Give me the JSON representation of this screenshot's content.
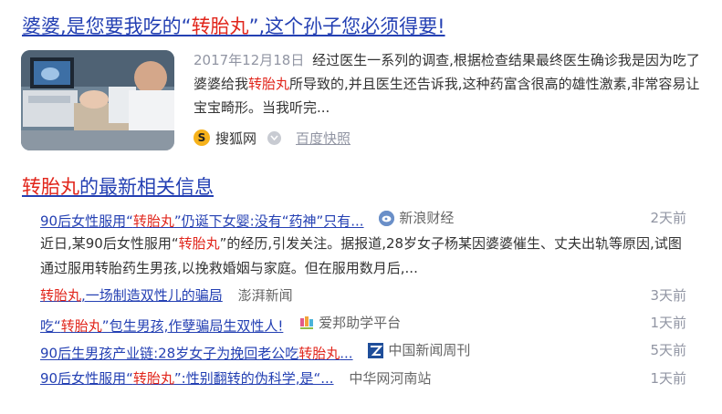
{
  "result1": {
    "title_pre": "婆婆,是您要我吃的“",
    "title_hl": "转胎丸",
    "title_post": "”,这个孙子您必须得要!",
    "date": "2017年12月18日",
    "abstract_1": "经过医生一系列的调查,根据检查结果最终医生确诊我是因为吃了婆婆给我",
    "abstract_hl": "转胎丸",
    "abstract_2": "所导致的,并且医生还告诉我,这种药富含很高的雄性激素,非常容易让宝宝畸形。当我听完...",
    "source_logo_char": "S",
    "source": "搜狐网",
    "kuaizhao": "百度快照"
  },
  "section": {
    "title_hl": "转胎丸",
    "title_rest": "的最新相关信息"
  },
  "news": [
    {
      "title_pre": "90后女性服用“",
      "title_hl": "转胎丸",
      "title_post": "”仍诞下女婴:没有“药神”只有...",
      "source": "新浪财经",
      "source_icon": "sina-finance-icon",
      "time": "2天前",
      "abstract_1": "近日,某90后女性服用“",
      "abstract_hl": "转胎丸",
      "abstract_2": "”的经历,引发关注。据报道,28岁女子杨某因婆婆催生、丈夫出轨等原因,试图通过服用转胎药生男孩,以挽救婚姻与家庭。但在服用数月后,..."
    },
    {
      "title_pre": "",
      "title_hl": "转胎丸",
      "title_post": ",一场制造双性儿的骗局",
      "source": "澎湃新闻",
      "time": "3天前"
    },
    {
      "title_pre": "吃“",
      "title_hl": "转胎丸",
      "title_post": "”包生男孩,作孽骗局生双性人!",
      "source": "爱邦助学平台",
      "source_icon": "aibang-icon",
      "time": "1天前"
    },
    {
      "title_pre": "90后生男孩产业链:28岁女子为挽回老公吃",
      "title_hl": "转胎丸",
      "title_post": "...",
      "source": "中国新闻周刊",
      "source_icon": "china-news-weekly-icon",
      "time": "5天前"
    },
    {
      "title_pre": "90后女性服用“",
      "title_hl": "转胎丸",
      "title_post": "”:性别翻转的伪科学,是“...",
      "source": "中华网河南站",
      "time": "1天前"
    }
  ],
  "colors": {
    "link": "#2440b3",
    "highlight": "#e1251b",
    "meta_gray": "#9195a3"
  }
}
